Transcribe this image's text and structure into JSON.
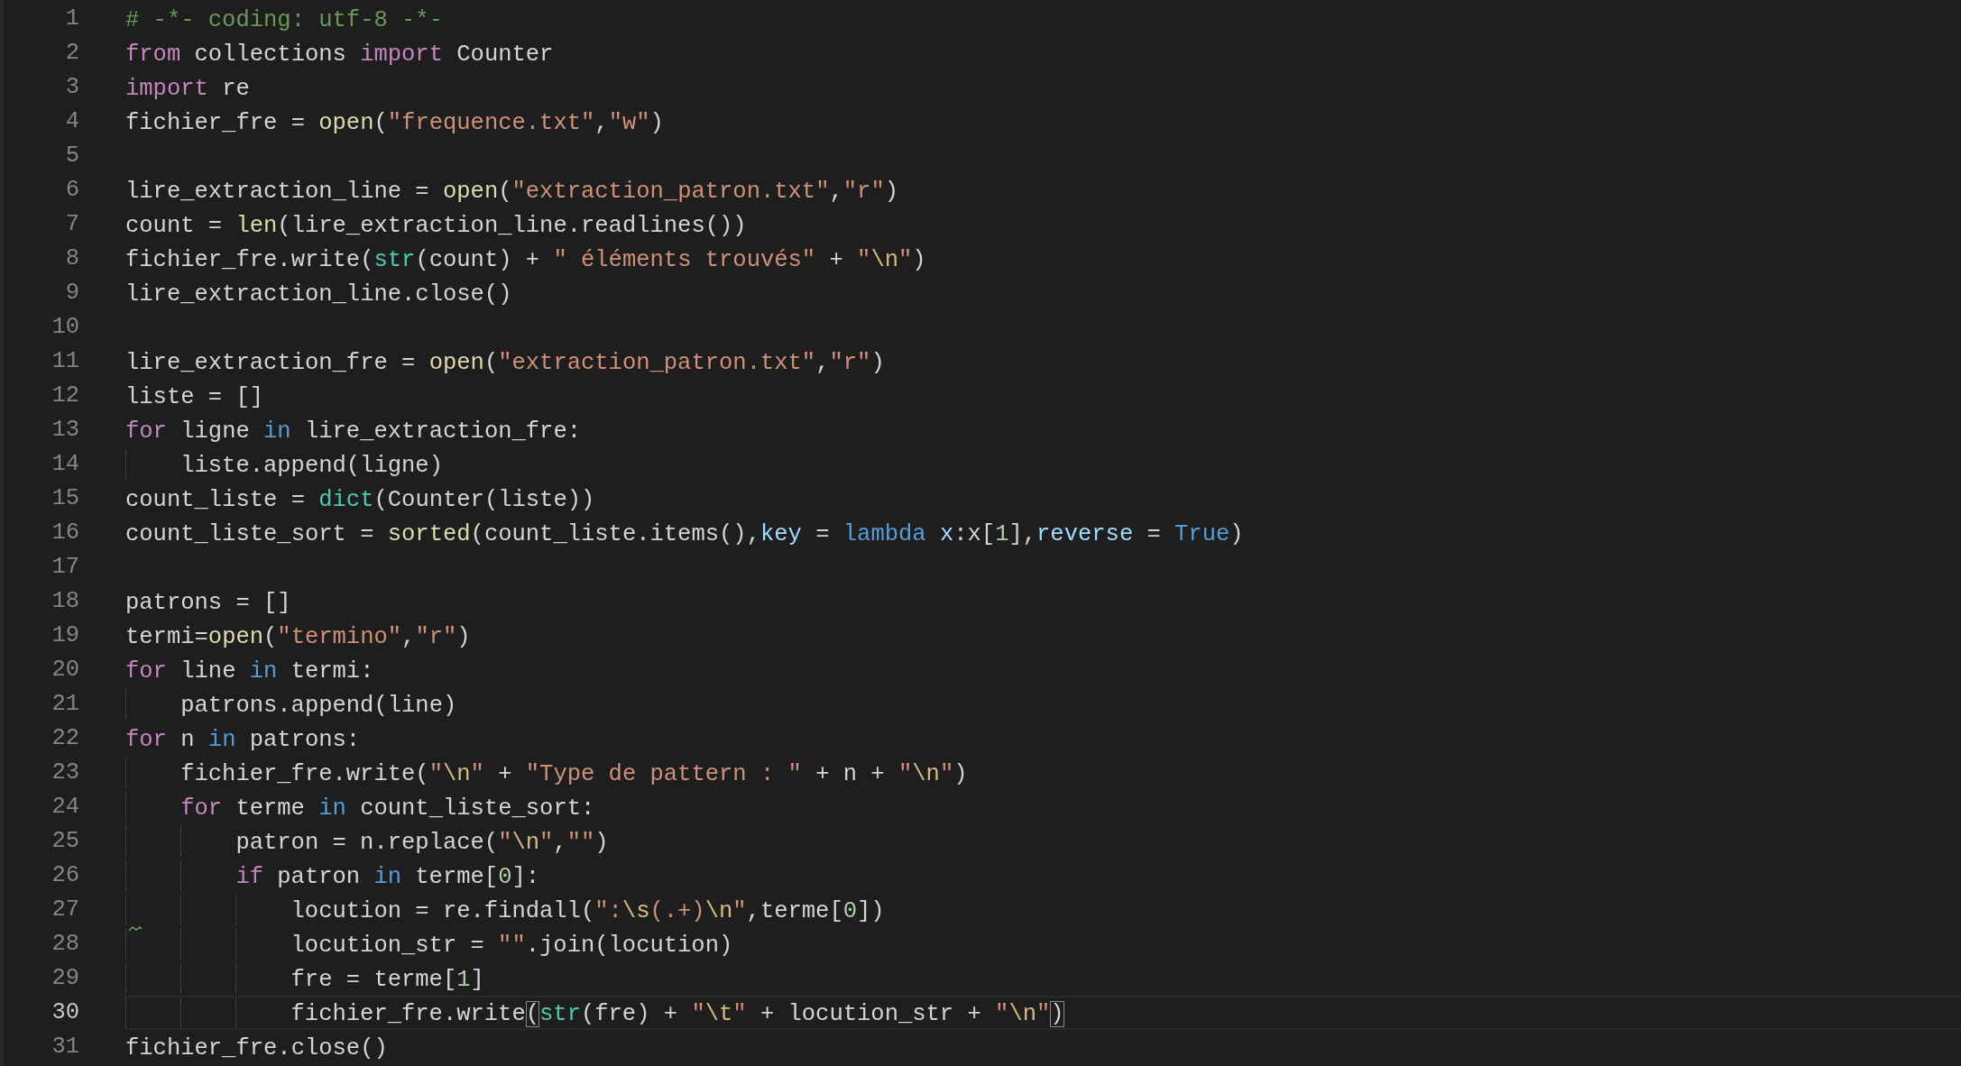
{
  "editor": {
    "lines": [
      {
        "number": "1",
        "selected": false,
        "warning": false,
        "tokens": [
          {
            "kind": "comment",
            "text": "# -*- coding: utf-8 -*-"
          }
        ]
      },
      {
        "number": "2",
        "selected": false,
        "warning": false,
        "tokens": [
          {
            "kind": "keyword",
            "text": "from"
          },
          {
            "kind": "plain",
            "text": " collections "
          },
          {
            "kind": "keyword",
            "text": "import"
          },
          {
            "kind": "plain",
            "text": " Counter"
          }
        ]
      },
      {
        "number": "3",
        "selected": false,
        "warning": false,
        "tokens": [
          {
            "kind": "keyword",
            "text": "import"
          },
          {
            "kind": "plain",
            "text": " re"
          }
        ]
      },
      {
        "number": "4",
        "selected": false,
        "warning": false,
        "tokens": [
          {
            "kind": "plain",
            "text": "fichier_fre = "
          },
          {
            "kind": "function",
            "text": "open"
          },
          {
            "kind": "plain",
            "text": "("
          },
          {
            "kind": "string",
            "text": "\"frequence.txt\""
          },
          {
            "kind": "plain",
            "text": ","
          },
          {
            "kind": "string",
            "text": "\"w\""
          },
          {
            "kind": "plain",
            "text": ")"
          }
        ]
      },
      {
        "number": "5",
        "selected": false,
        "warning": false
      },
      {
        "number": "6",
        "selected": false,
        "warning": false,
        "tokens": [
          {
            "kind": "plain",
            "text": "lire_extraction_line = "
          },
          {
            "kind": "function",
            "text": "open"
          },
          {
            "kind": "plain",
            "text": "("
          },
          {
            "kind": "string",
            "text": "\"extraction_patron.txt\""
          },
          {
            "kind": "plain",
            "text": ","
          },
          {
            "kind": "string",
            "text": "\"r\""
          },
          {
            "kind": "plain",
            "text": ")"
          }
        ]
      },
      {
        "number": "7",
        "selected": false,
        "warning": false,
        "tokens": [
          {
            "kind": "plain",
            "text": "count = "
          },
          {
            "kind": "function",
            "text": "len"
          },
          {
            "kind": "plain",
            "text": "(lire_extraction_line.readlines())"
          }
        ]
      },
      {
        "number": "8",
        "selected": false,
        "warning": false,
        "tokens": [
          {
            "kind": "plain",
            "text": "fichier_fre.write("
          },
          {
            "kind": "builtin",
            "text": "str"
          },
          {
            "kind": "plain",
            "text": "(count) + "
          },
          {
            "kind": "string",
            "text": "\" éléments trouvés\""
          },
          {
            "kind": "plain",
            "text": " + "
          },
          {
            "kind": "string",
            "text": "\""
          },
          {
            "kind": "escape",
            "text": "\\n"
          },
          {
            "kind": "string",
            "text": "\""
          },
          {
            "kind": "plain",
            "text": ")"
          }
        ]
      },
      {
        "number": "9",
        "selected": false,
        "warning": false,
        "tokens": [
          {
            "kind": "plain",
            "text": "lire_extraction_line.close()"
          }
        ]
      },
      {
        "number": "10",
        "selected": false,
        "warning": false
      },
      {
        "number": "11",
        "selected": false,
        "warning": false,
        "tokens": [
          {
            "kind": "plain",
            "text": "lire_extraction_fre = "
          },
          {
            "kind": "function",
            "text": "open"
          },
          {
            "kind": "plain",
            "text": "("
          },
          {
            "kind": "string",
            "text": "\"extraction_patron.txt\""
          },
          {
            "kind": "plain",
            "text": ","
          },
          {
            "kind": "string",
            "text": "\"r\""
          },
          {
            "kind": "plain",
            "text": ")"
          }
        ]
      },
      {
        "number": "12",
        "selected": false,
        "warning": false,
        "tokens": [
          {
            "kind": "plain",
            "text": "liste = []"
          }
        ]
      },
      {
        "number": "13",
        "selected": false,
        "warning": false,
        "tokens": [
          {
            "kind": "keyword",
            "text": "for"
          },
          {
            "kind": "plain",
            "text": " ligne "
          },
          {
            "kind": "operator",
            "text": "in"
          },
          {
            "kind": "plain",
            "text": " lire_extraction_fre:"
          }
        ],
        "children": [
          {
            "number": "14",
            "selected": false,
            "warning": false,
            "tokens": [
              {
                "kind": "plain",
                "text": "liste.append(ligne)"
              }
            ]
          }
        ]
      },
      {
        "number": "15",
        "selected": false,
        "warning": false,
        "tokens": [
          {
            "kind": "plain",
            "text": "count_liste = "
          },
          {
            "kind": "builtin",
            "text": "dict"
          },
          {
            "kind": "plain",
            "text": "(Counter(liste))"
          }
        ]
      },
      {
        "number": "16",
        "selected": false,
        "warning": false,
        "tokens": [
          {
            "kind": "plain",
            "text": "count_liste_sort = "
          },
          {
            "kind": "function",
            "text": "sorted"
          },
          {
            "kind": "plain",
            "text": "(count_liste.items(),"
          },
          {
            "kind": "parameter",
            "text": "key"
          },
          {
            "kind": "plain",
            "text": " = "
          },
          {
            "kind": "operator",
            "text": "lambda "
          },
          {
            "kind": "parameter",
            "text": "x"
          },
          {
            "kind": "plain",
            "text": ":x["
          },
          {
            "kind": "number",
            "text": "1"
          },
          {
            "kind": "plain",
            "text": "],"
          },
          {
            "kind": "parameter",
            "text": "reverse"
          },
          {
            "kind": "plain",
            "text": " = "
          },
          {
            "kind": "operator",
            "text": "True"
          },
          {
            "kind": "plain",
            "text": ")"
          }
        ]
      },
      {
        "number": "17",
        "selected": false,
        "warning": false
      },
      {
        "number": "18",
        "selected": false,
        "warning": false,
        "tokens": [
          {
            "kind": "plain",
            "text": "patrons = []"
          }
        ]
      },
      {
        "number": "19",
        "selected": false,
        "warning": false,
        "tokens": [
          {
            "kind": "plain",
            "text": "termi="
          },
          {
            "kind": "function",
            "text": "open"
          },
          {
            "kind": "plain",
            "text": "("
          },
          {
            "kind": "string",
            "text": "\"termino\""
          },
          {
            "kind": "plain",
            "text": ","
          },
          {
            "kind": "string",
            "text": "\"r\""
          },
          {
            "kind": "plain",
            "text": ")"
          }
        ]
      },
      {
        "number": "20",
        "selected": false,
        "warning": false,
        "tokens": [
          {
            "kind": "keyword",
            "text": "for"
          },
          {
            "kind": "plain",
            "text": " line "
          },
          {
            "kind": "operator",
            "text": "in"
          },
          {
            "kind": "plain",
            "text": " termi:"
          }
        ],
        "children": [
          {
            "number": "21",
            "selected": false,
            "warning": false,
            "tokens": [
              {
                "kind": "plain",
                "text": "patrons.append(line)"
              }
            ]
          }
        ]
      },
      {
        "number": "22",
        "selected": false,
        "warning": false,
        "tokens": [
          {
            "kind": "keyword",
            "text": "for"
          },
          {
            "kind": "plain",
            "text": " n "
          },
          {
            "kind": "operator",
            "text": "in"
          },
          {
            "kind": "plain",
            "text": " patrons:"
          }
        ],
        "children": [
          {
            "number": "23",
            "selected": false,
            "warning": false,
            "tokens": [
              {
                "kind": "plain",
                "text": "fichier_fre.write("
              },
              {
                "kind": "string",
                "text": "\""
              },
              {
                "kind": "escape",
                "text": "\\n"
              },
              {
                "kind": "string",
                "text": "\""
              },
              {
                "kind": "plain",
                "text": " + "
              },
              {
                "kind": "string",
                "text": "\"Type de pattern : \""
              },
              {
                "kind": "plain",
                "text": " + n + "
              },
              {
                "kind": "string",
                "text": "\""
              },
              {
                "kind": "escape",
                "text": "\\n"
              },
              {
                "kind": "string",
                "text": "\""
              },
              {
                "kind": "plain",
                "text": ")"
              }
            ]
          },
          {
            "number": "24",
            "selected": false,
            "warning": false,
            "tokens": [
              {
                "kind": "keyword",
                "text": "for"
              },
              {
                "kind": "plain",
                "text": " terme "
              },
              {
                "kind": "operator",
                "text": "in"
              },
              {
                "kind": "plain",
                "text": " count_liste_sort:"
              }
            ],
            "children": [
              {
                "number": "25",
                "selected": false,
                "warning": false,
                "tokens": [
                  {
                    "kind": "plain",
                    "text": "patron = n.replace("
                  },
                  {
                    "kind": "string",
                    "text": "\""
                  },
                  {
                    "kind": "escape",
                    "text": "\\n"
                  },
                  {
                    "kind": "string",
                    "text": "\""
                  },
                  {
                    "kind": "plain",
                    "text": ","
                  },
                  {
                    "kind": "string",
                    "text": "\"\""
                  },
                  {
                    "kind": "plain",
                    "text": ")"
                  }
                ]
              },
              {
                "number": "26",
                "selected": false,
                "warning": false,
                "tokens": [
                  {
                    "kind": "keyword",
                    "text": "if"
                  },
                  {
                    "kind": "plain",
                    "text": " patron "
                  },
                  {
                    "kind": "operator",
                    "text": "in"
                  },
                  {
                    "kind": "plain",
                    "text": " terme["
                  },
                  {
                    "kind": "number",
                    "text": "0"
                  },
                  {
                    "kind": "plain",
                    "text": "]:"
                  }
                ],
                "children": [
                  {
                    "number": "27",
                    "selected": false,
                    "warning": true,
                    "tokens": [
                      {
                        "kind": "plain",
                        "text": "locution = re.findall("
                      },
                      {
                        "kind": "string",
                        "text": "\":"
                      },
                      {
                        "kind": "escape",
                        "text": "\\s"
                      },
                      {
                        "kind": "string",
                        "text": "(.+)"
                      },
                      {
                        "kind": "escape",
                        "text": "\\n"
                      },
                      {
                        "kind": "string",
                        "text": "\""
                      },
                      {
                        "kind": "plain",
                        "text": ",terme["
                      },
                      {
                        "kind": "number",
                        "text": "0"
                      },
                      {
                        "kind": "plain",
                        "text": "])"
                      }
                    ]
                  },
                  {
                    "number": "28",
                    "selected": false,
                    "warning": false,
                    "tokens": [
                      {
                        "kind": "plain",
                        "text": "locution_str = "
                      },
                      {
                        "kind": "string",
                        "text": "\"\""
                      },
                      {
                        "kind": "plain",
                        "text": ".join(locution)"
                      }
                    ]
                  },
                  {
                    "number": "29",
                    "selected": false,
                    "warning": false,
                    "tokens": [
                      {
                        "kind": "plain",
                        "text": "fre = terme["
                      },
                      {
                        "kind": "number",
                        "text": "1"
                      },
                      {
                        "kind": "plain",
                        "text": "]"
                      }
                    ]
                  },
                  {
                    "number": "30",
                    "selected": true,
                    "warning": false,
                    "tokens": [
                      {
                        "kind": "plain",
                        "text": "fichier_fre.write"
                      },
                      {
                        "kind": "match",
                        "text": "("
                      },
                      {
                        "kind": "builtin",
                        "text": "str"
                      },
                      {
                        "kind": "plain",
                        "text": "(fre) + "
                      },
                      {
                        "kind": "string",
                        "text": "\""
                      },
                      {
                        "kind": "escape",
                        "text": "\\t"
                      },
                      {
                        "kind": "string",
                        "text": "\""
                      },
                      {
                        "kind": "plain",
                        "text": " + locution_str + "
                      },
                      {
                        "kind": "string",
                        "text": "\""
                      },
                      {
                        "kind": "escape",
                        "text": "\\n"
                      },
                      {
                        "kind": "string",
                        "text": "\""
                      },
                      {
                        "kind": "match",
                        "text": ")"
                      }
                    ]
                  }
                ]
              }
            ]
          }
        ]
      },
      {
        "number": "31",
        "selected": false,
        "warning": false,
        "tokens": [
          {
            "kind": "plain",
            "text": "fichier_fre.close()"
          }
        ]
      }
    ]
  }
}
